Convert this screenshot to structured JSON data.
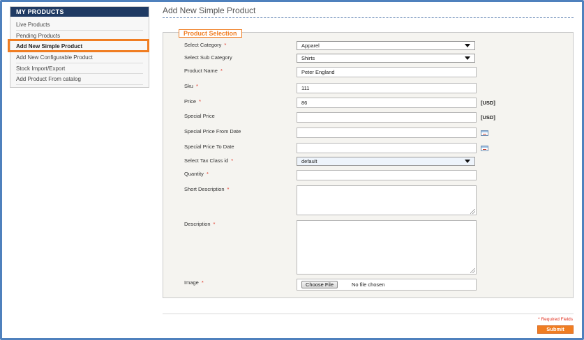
{
  "sidebar": {
    "title": "MY PRODUCTS",
    "items": [
      {
        "label": "Live Products"
      },
      {
        "label": "Pending Products"
      },
      {
        "label": "Add New Simple Product"
      },
      {
        "label": "Add New Configurable Product"
      },
      {
        "label": "Stock Import/Export"
      },
      {
        "label": "Add Product From catalog"
      }
    ],
    "active_index": 2
  },
  "page": {
    "title": "Add New Simple Product"
  },
  "form": {
    "section_title": "Product Selection",
    "required_mark": "*",
    "fields": {
      "category": {
        "label": "Select Category",
        "value": "Apparel"
      },
      "sub_category": {
        "label": "Select Sub Category",
        "value": "Shirts"
      },
      "product_name": {
        "label": "Product Name",
        "value": "Peter England"
      },
      "sku": {
        "label": "Sku",
        "value": "111"
      },
      "price": {
        "label": "Price",
        "value": "86",
        "unit": "[USD]"
      },
      "special_price": {
        "label": "Special Price",
        "value": "",
        "unit": "[USD]"
      },
      "special_from": {
        "label": "Special Price From Date",
        "value": ""
      },
      "special_to": {
        "label": "Special Price To Date",
        "value": ""
      },
      "tax_class": {
        "label": "Select Tax Class id",
        "value": "default"
      },
      "quantity": {
        "label": "Quantity",
        "value": ""
      },
      "short_description": {
        "label": "Short Description",
        "value": ""
      },
      "description": {
        "label": "Description",
        "value": ""
      },
      "image": {
        "label": "Image",
        "button": "Choose File",
        "status": "No file chosen"
      }
    },
    "required_note": "* Required Fields",
    "submit_label": "Submit"
  },
  "colors": {
    "accent": "#f07d22",
    "sidebar_header": "#1f3a63",
    "frame": "#4f81bd",
    "required": "#e03020"
  },
  "icons": {
    "dropdown": "caret-down-icon",
    "calendar": "calendar-icon",
    "resize": "resize-grip-icon"
  }
}
